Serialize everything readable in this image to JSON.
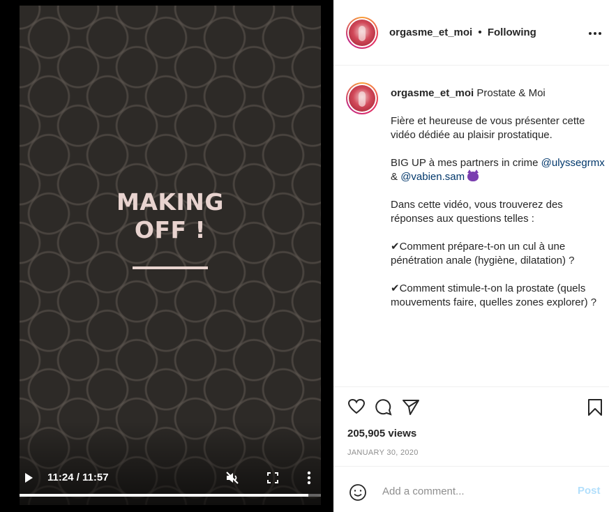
{
  "video": {
    "title_line1": "MAKING",
    "title_line2": "OFF !",
    "time_display": "11:24 / 11:57",
    "progress_fraction": 0.9585
  },
  "header": {
    "username": "orgasme_et_moi",
    "separator": "•",
    "follow_status": "Following"
  },
  "caption": {
    "username": "orgasme_et_moi",
    "title": "Prostate & Moi",
    "paragraph1": "Fière et heureuse de vous présenter cette vidéo dédiée au plaisir prostatique.",
    "paragraph2_prefix": "BIG UP à mes partners in crime ",
    "mention1": "@ulyssegrmx",
    "paragraph2_joiner": " & ",
    "mention2": "@vabien.sam",
    "paragraph3": "Dans cette vidéo, vous trouverez des réponses aux questions telles :",
    "paragraph4": "✔Comment prépare-t-on un cul à une pénétration anale (hygiène, dilatation) ?",
    "paragraph5": "✔Comment stimule-t-on la prostate (quels mouvements faire, quelles zones explorer) ?"
  },
  "stats": {
    "views": "205,905 views",
    "date": "JANUARY 30, 2020"
  },
  "comment": {
    "placeholder": "Add a comment...",
    "post_label": "Post"
  },
  "icons": [
    "play-icon",
    "mute-icon",
    "fullscreen-icon",
    "more-icon",
    "options-icon",
    "heart-icon",
    "comment-icon",
    "share-icon",
    "bookmark-icon",
    "emoji-icon",
    "devil-emoji-icon"
  ],
  "colors": {
    "mention": "#00376b",
    "post_disabled": "#b2dffc",
    "video_title": "#e8d3cf",
    "muted_text": "#8e8e8e"
  }
}
